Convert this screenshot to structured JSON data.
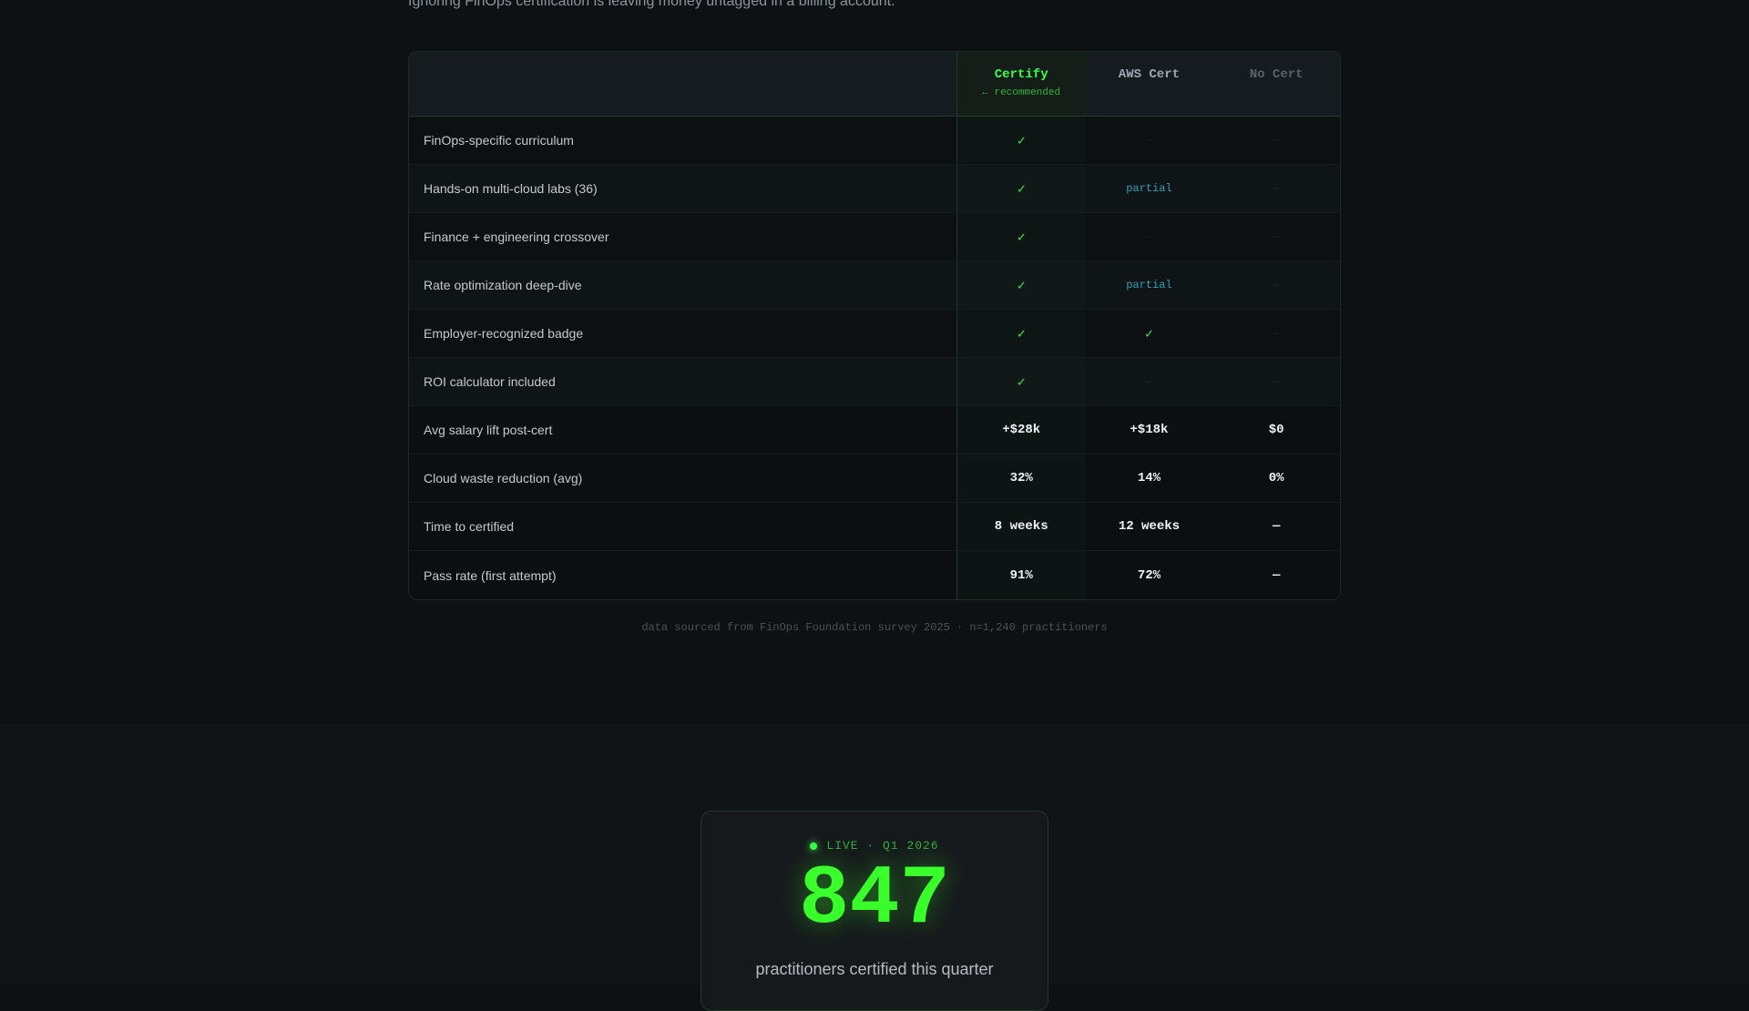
{
  "intro_text": "Ignoring FinOps certification is leaving money untagged in a billing account.",
  "columns": [
    {
      "label": "Certify",
      "sub": "← recommended"
    },
    {
      "label": "AWS Cert",
      "sub": ""
    },
    {
      "label": "No Cert",
      "sub": ""
    }
  ],
  "rows": [
    {
      "feature": "FinOps-specific curriculum",
      "cells": [
        {
          "t": "check",
          "v": "✓"
        },
        {
          "t": "dash",
          "v": "—"
        },
        {
          "t": "dash",
          "v": "—"
        }
      ]
    },
    {
      "feature": "Hands-on multi-cloud labs (36)",
      "cells": [
        {
          "t": "check",
          "v": "✓"
        },
        {
          "t": "partial",
          "v": "partial"
        },
        {
          "t": "dash",
          "v": "—"
        }
      ]
    },
    {
      "feature": "Finance + engineering crossover",
      "cells": [
        {
          "t": "check",
          "v": "✓"
        },
        {
          "t": "dash",
          "v": "—"
        },
        {
          "t": "dash",
          "v": "—"
        }
      ]
    },
    {
      "feature": "Rate optimization deep-dive",
      "cells": [
        {
          "t": "check",
          "v": "✓"
        },
        {
          "t": "partial",
          "v": "partial"
        },
        {
          "t": "dash",
          "v": "—"
        }
      ]
    },
    {
      "feature": "Employer-recognized badge",
      "cells": [
        {
          "t": "check",
          "v": "✓"
        },
        {
          "t": "check",
          "v": "✓"
        },
        {
          "t": "dash",
          "v": "—"
        }
      ]
    },
    {
      "feature": "ROI calculator included",
      "cells": [
        {
          "t": "check",
          "v": "✓"
        },
        {
          "t": "dash",
          "v": "—"
        },
        {
          "t": "dash",
          "v": "—"
        }
      ]
    },
    {
      "feature": "Avg salary lift post-cert",
      "cells": [
        {
          "t": "val",
          "v": "+$28k"
        },
        {
          "t": "val",
          "v": "+$18k"
        },
        {
          "t": "val",
          "v": "$0"
        }
      ]
    },
    {
      "feature": "Cloud waste reduction (avg)",
      "cells": [
        {
          "t": "val",
          "v": "32%"
        },
        {
          "t": "val",
          "v": "14%"
        },
        {
          "t": "val",
          "v": "0%"
        }
      ]
    },
    {
      "feature": "Time to certified",
      "cells": [
        {
          "t": "val",
          "v": "8 weeks"
        },
        {
          "t": "val",
          "v": "12 weeks"
        },
        {
          "t": "nil",
          "v": "—"
        }
      ]
    },
    {
      "feature": "Pass rate (first attempt)",
      "cells": [
        {
          "t": "val",
          "v": "91%"
        },
        {
          "t": "val",
          "v": "72%"
        },
        {
          "t": "nil",
          "v": "—"
        }
      ]
    }
  ],
  "footnote": "data sourced from FinOps Foundation survey 2025 · n=1,240 practitioners",
  "live": {
    "tag": "LIVE · Q1 2026",
    "count": "847",
    "caption": "practitioners certified this quarter"
  },
  "colors": {
    "accent": "#39ff4a",
    "partial": "#2aa2b8"
  }
}
